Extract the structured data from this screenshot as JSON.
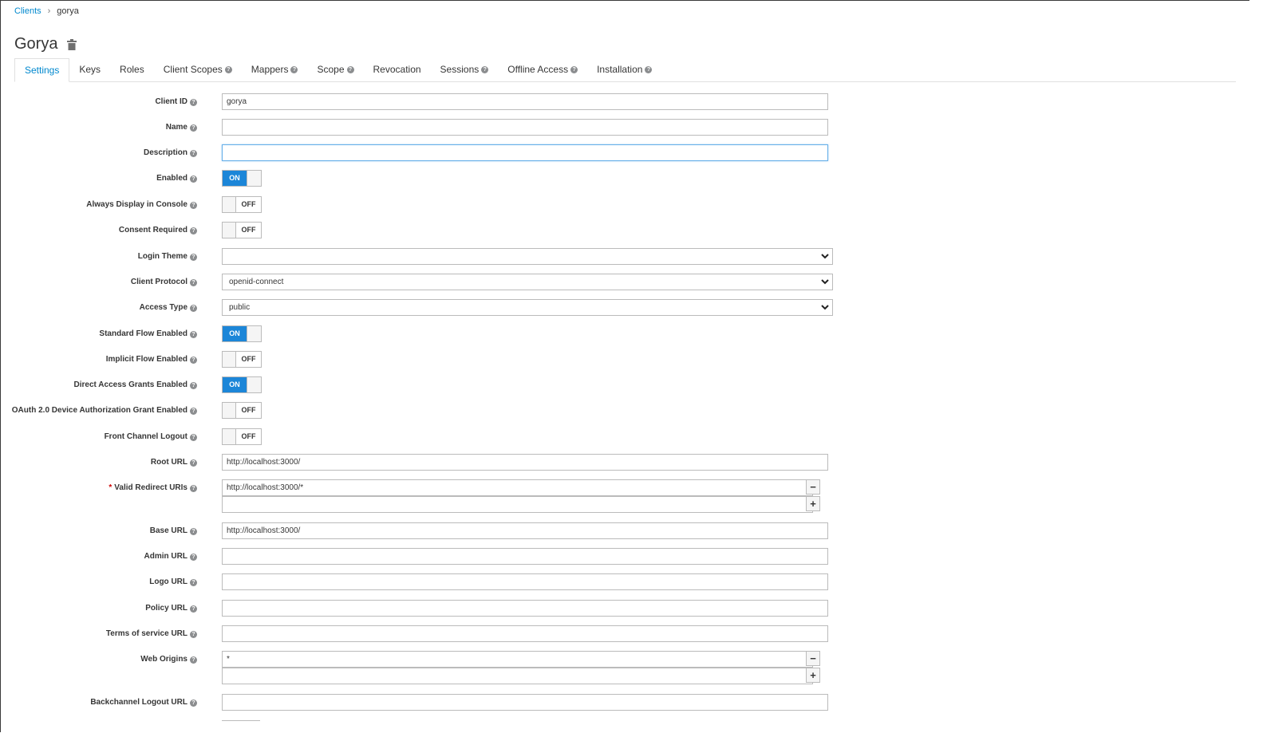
{
  "breadcrumb": {
    "parent": "Clients",
    "current": "gorya"
  },
  "title": "Gorya",
  "tabs": [
    {
      "label": "Settings",
      "help": false
    },
    {
      "label": "Keys",
      "help": false
    },
    {
      "label": "Roles",
      "help": false
    },
    {
      "label": "Client Scopes",
      "help": true
    },
    {
      "label": "Mappers",
      "help": true
    },
    {
      "label": "Scope",
      "help": true
    },
    {
      "label": "Revocation",
      "help": false
    },
    {
      "label": "Sessions",
      "help": true
    },
    {
      "label": "Offline Access",
      "help": true
    },
    {
      "label": "Installation",
      "help": true
    }
  ],
  "form": {
    "client_id": {
      "label": "Client ID",
      "value": "gorya"
    },
    "name": {
      "label": "Name",
      "value": ""
    },
    "description": {
      "label": "Description",
      "value": ""
    },
    "enabled": {
      "label": "Enabled",
      "state": "ON"
    },
    "always_display": {
      "label": "Always Display in Console",
      "state": "OFF"
    },
    "consent_required": {
      "label": "Consent Required",
      "state": "OFF"
    },
    "login_theme": {
      "label": "Login Theme",
      "value": ""
    },
    "client_protocol": {
      "label": "Client Protocol",
      "value": "openid-connect"
    },
    "access_type": {
      "label": "Access Type",
      "value": "public"
    },
    "standard_flow": {
      "label": "Standard Flow Enabled",
      "state": "ON"
    },
    "implicit_flow": {
      "label": "Implicit Flow Enabled",
      "state": "OFF"
    },
    "direct_access": {
      "label": "Direct Access Grants Enabled",
      "state": "ON"
    },
    "device_auth": {
      "label": "OAuth 2.0 Device Authorization Grant Enabled",
      "state": "OFF"
    },
    "front_channel": {
      "label": "Front Channel Logout",
      "state": "OFF"
    },
    "root_url": {
      "label": "Root URL",
      "value": "http://localhost:3000/"
    },
    "redirect_uris": {
      "label": "Valid Redirect URIs",
      "required_mark": "*",
      "values": [
        "http://localhost:3000/*",
        ""
      ],
      "remove": "−",
      "add": "+"
    },
    "base_url": {
      "label": "Base URL",
      "value": "http://localhost:3000/"
    },
    "admin_url": {
      "label": "Admin URL",
      "value": ""
    },
    "logo_url": {
      "label": "Logo URL",
      "value": ""
    },
    "policy_url": {
      "label": "Policy URL",
      "value": ""
    },
    "tos_url": {
      "label": "Terms of service URL",
      "value": ""
    },
    "web_origins": {
      "label": "Web Origins",
      "values": [
        "*",
        ""
      ],
      "remove": "−",
      "add": "+"
    },
    "backchannel_url": {
      "label": "Backchannel Logout URL",
      "value": ""
    }
  },
  "help_icon": "?"
}
